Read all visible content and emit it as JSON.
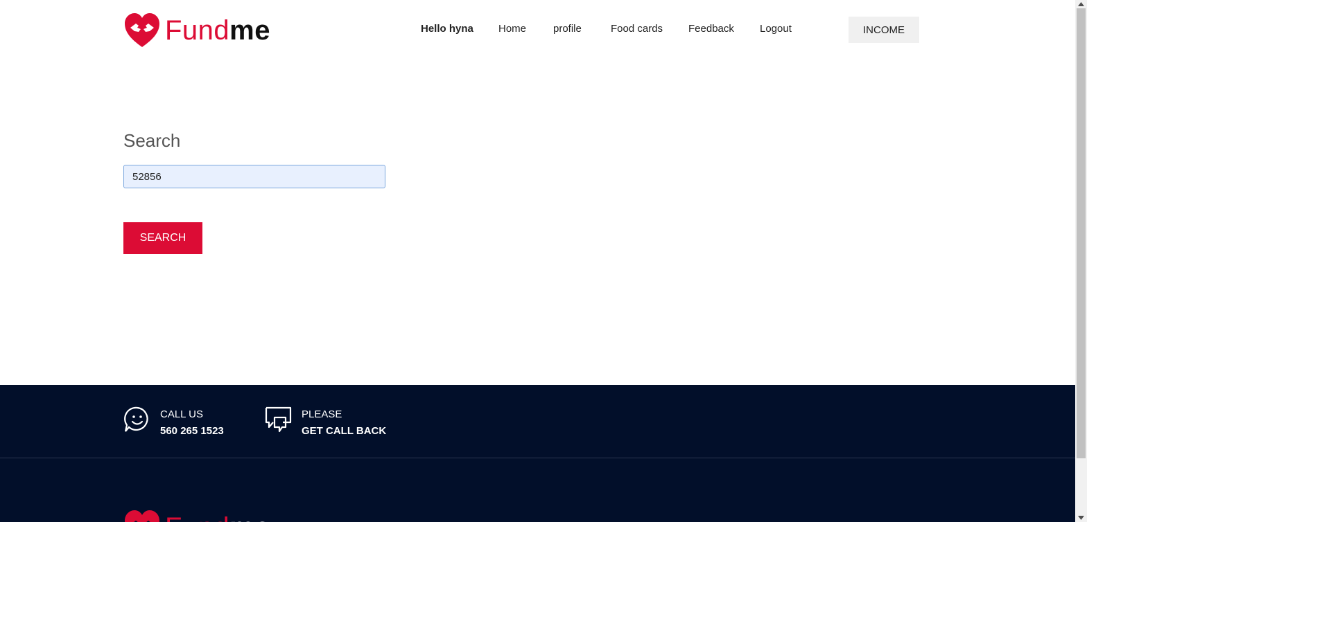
{
  "brand": {
    "part1": "Fund",
    "part2": "me",
    "primary_color": "#dc0c35"
  },
  "nav": {
    "greeting": "Hello hyna",
    "items": [
      "Home",
      "profile",
      "Food cards",
      "Feedback",
      "Logout"
    ],
    "income_label": "INCOME"
  },
  "search": {
    "title": "Search",
    "value": "52856",
    "button_label": "SEARCH"
  },
  "footer": {
    "background": "#020f2a",
    "call": {
      "label": "CALL US",
      "number": "560 265 1523",
      "icon": "smiley-chat-icon"
    },
    "callback": {
      "line1": "PLEASE",
      "line2": "GET CALL BACK",
      "icon": "chat-bubbles-icon"
    }
  }
}
